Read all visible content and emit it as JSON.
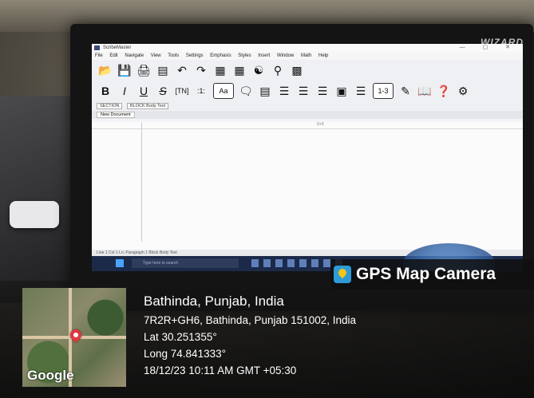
{
  "monitor": {
    "brand": "WIZARD",
    "app_title": "ScribeMaster",
    "window_controls": "— ▢ ✕",
    "menu": [
      "File",
      "Edit",
      "Navigate",
      "View",
      "Tools",
      "Settings",
      "Emphasis",
      "Styles",
      "Insert",
      "Window",
      "Math",
      "Help"
    ],
    "format_buttons": [
      "B",
      "I",
      "U",
      "S",
      "[TN]",
      ":1:",
      "Aa"
    ],
    "breadcrumb": [
      "SECTION",
      "BLOCK Body Text"
    ],
    "doc_tab": "New Document",
    "page_label": "0+0",
    "status_text": "Line 1  Col 1  Ln: Paragraph 1  Block Body Text",
    "taskbar_search": "Type here to search"
  },
  "overlay": {
    "badge_text": "GPS Map Camera",
    "map_provider": "Google",
    "location_title": "Bathinda, Punjab, India",
    "address": "7R2R+GH6, Bathinda, Punjab 151002, India",
    "latitude": "Lat 30.251355°",
    "longitude": "Long 74.841333°",
    "timestamp": "18/12/23 10:11 AM GMT +05:30"
  }
}
